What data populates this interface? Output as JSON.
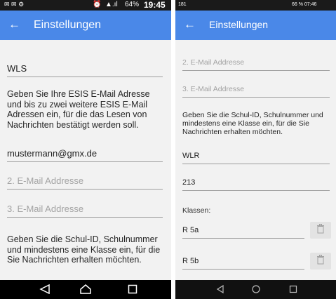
{
  "left": {
    "status": {
      "time": "19:45",
      "battery": "64%"
    },
    "appbar": {
      "title": "Einstellungen",
      "back_icon": "arrow-back-icon"
    },
    "name_field": "WLS",
    "info_email": "Geben Sie Ihre ESIS E-Mail Adresse und bis zu zwei weitere ESIS E-Mail Adressen ein, für die das Lesen von Nachrichten bestätigt werden soll.",
    "email1": "mustermann@gmx.de",
    "email2_placeholder": "2. E-Mail Addresse",
    "email3_placeholder": "3. E-Mail Addresse",
    "info_school": "Geben Sie die Schul-ID, Schulnummer und mindestens eine Klasse ein, für die Sie Nachrichten erhalten möchten."
  },
  "right": {
    "status": {
      "left": "181",
      "right": "66 % 07:46"
    },
    "appbar": {
      "title": "Einstellungen",
      "back_icon": "arrow-back-icon"
    },
    "email2_placeholder": "2. E-Mail Addresse",
    "email3_placeholder": "3. E-Mail Addresse",
    "info_school": "Geben Sie die Schul-ID, Schulnummer und mindestens eine Klasse ein, für die Sie Nachrichten erhalten möchten.",
    "school_id": "WLR",
    "school_number": "213",
    "classes_label": "Klassen:",
    "classes": [
      "R 5a",
      "R 5b"
    ]
  },
  "colors": {
    "appbar": "#4a88e8",
    "statusbar": "#1a1a1a",
    "background": "#f2f2f2"
  }
}
